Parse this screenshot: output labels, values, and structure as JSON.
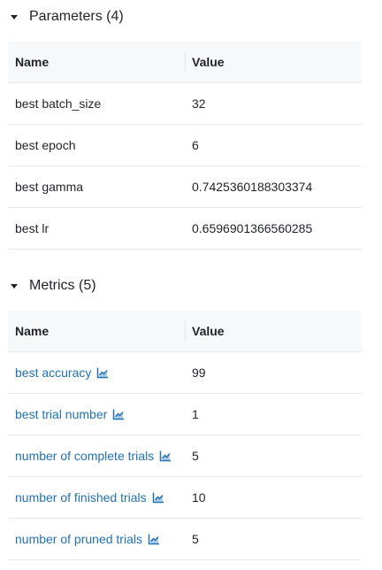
{
  "parameters": {
    "title": "Parameters (4)",
    "columns": {
      "name": "Name",
      "value": "Value"
    },
    "rows": [
      {
        "name": "best batch_size",
        "value": "32"
      },
      {
        "name": "best epoch",
        "value": "6"
      },
      {
        "name": "best gamma",
        "value": "0.7425360188303374"
      },
      {
        "name": "best lr",
        "value": "0.6596901366560285"
      }
    ]
  },
  "metrics": {
    "title": "Metrics (5)",
    "columns": {
      "name": "Name",
      "value": "Value"
    },
    "rows": [
      {
        "name": "best accuracy",
        "value": "99",
        "icon": "line-chart-icon"
      },
      {
        "name": "best trial number",
        "value": "1",
        "icon": "line-chart-icon"
      },
      {
        "name": "number of complete trials",
        "value": "5",
        "icon": "line-chart-icon"
      },
      {
        "name": "number of finished trials",
        "value": "10",
        "icon": "line-chart-icon"
      },
      {
        "name": "number of pruned trials",
        "value": "5",
        "icon": "line-chart-icon"
      }
    ]
  },
  "colors": {
    "link": "#2272b4",
    "header_bg": "#f7f8f9",
    "border": "#e6e8eb"
  }
}
